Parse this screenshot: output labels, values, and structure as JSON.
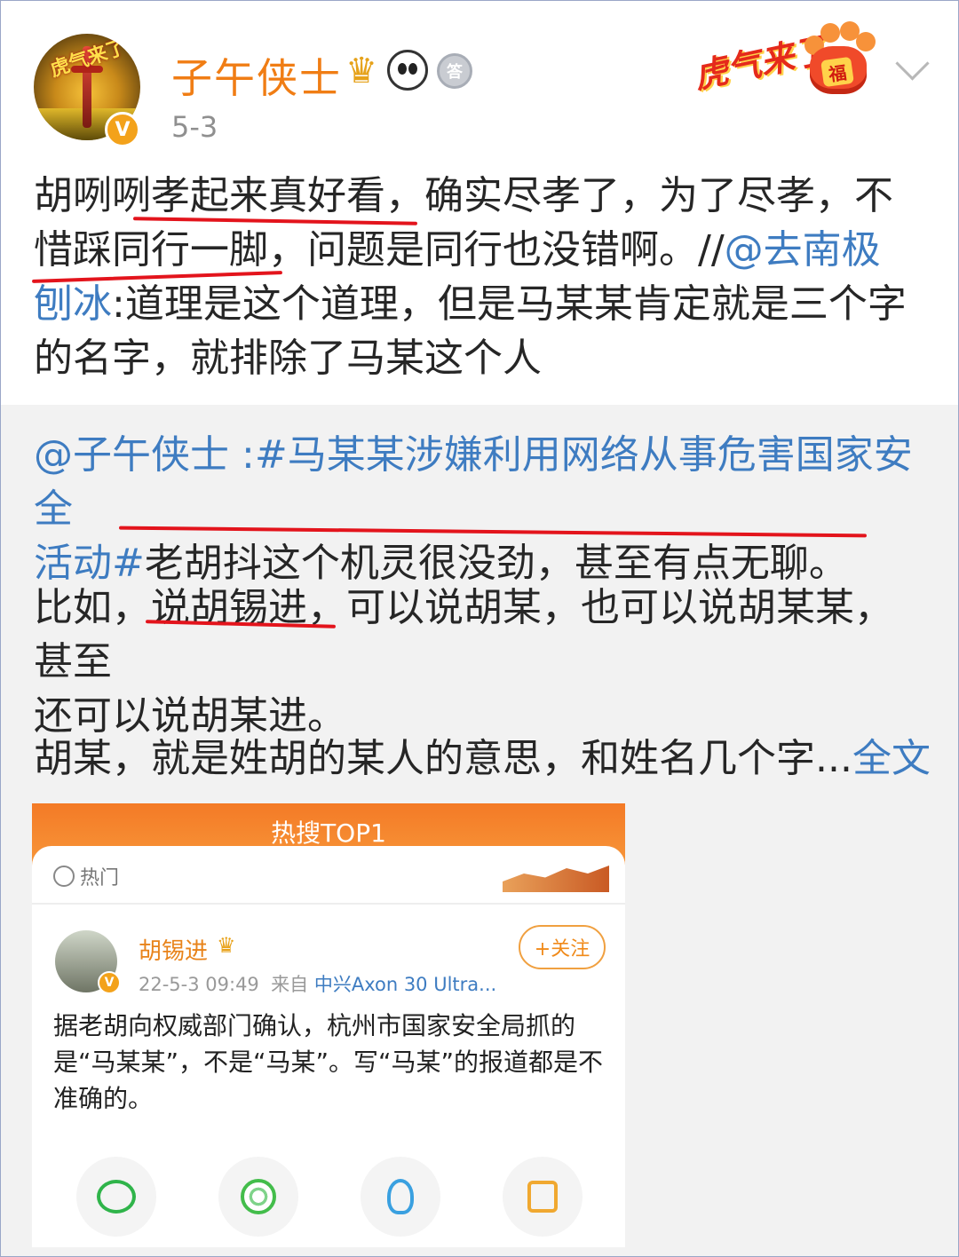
{
  "post": {
    "username": "子午侠士",
    "date": "5-3",
    "avatar_caption": "虎气来了",
    "verified_mark": "V",
    "medal_char": "答",
    "decoration_text": "虎气来了",
    "decoration_fu": "福",
    "body_line1_a": "胡咧咧孝起来真好看，确实尽孝了，为了尽孝，不",
    "body_line2_a": "惜踩同行一脚，问题是同行也没错啊。//",
    "mention_1": "@去南极",
    "mention_1b": "刨冰",
    "body_line3_rest": ":道理是这个道理，但是马某某肯定就是三个字",
    "body_line4": "的名字，就排除了马某这个人"
  },
  "retweet": {
    "mention": "@子午侠士",
    "topic": ":#马某某涉嫌利用网络从事危害国家安全",
    "topic_end": "活动#",
    "line2_rest": "老胡抖这个机灵很没劲，甚至有点无聊。",
    "para2_line1": "比如，说胡锡进，可以说胡某，也可以说胡某某，甚至",
    "para2_line2": "还可以说胡某进。",
    "para3": "胡某，就是姓胡的某人的意思，和姓名几个字...",
    "full_text_link": "全文"
  },
  "embedded": {
    "header_title": "热搜TOP1",
    "hot_label": "热门",
    "author": "胡锡进",
    "timestamp": "22-5-3 09:49",
    "from_label": "来自",
    "source": "中兴Axon 30 Ultra...",
    "follow_label": "+关注",
    "body": "据老胡向权威部门确认，杭州市国家安全局抓的是“马某某”，不是“马某”。写“马某”的报道都是不准确的。",
    "share_icons": [
      "wechat-icon",
      "moments-icon",
      "qq-icon",
      "save-image-icon"
    ]
  },
  "colors": {
    "username": "#f07d14",
    "link": "#3e7cc1",
    "underline": "#e3141c",
    "embedded_header": "#f47a26"
  }
}
